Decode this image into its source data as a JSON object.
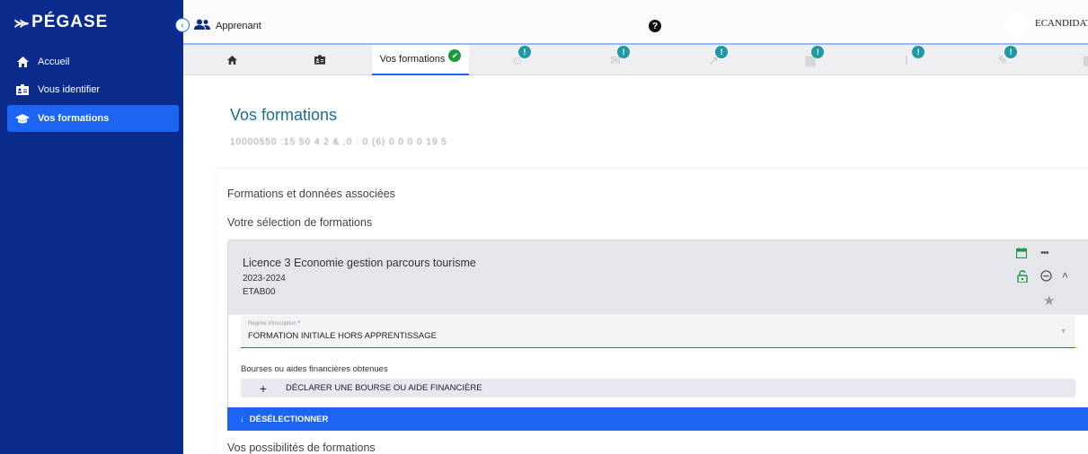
{
  "sidebar": {
    "brand": "PÉGASE",
    "items": [
      {
        "label": "Accueil",
        "icon": "home-icon"
      },
      {
        "label": "Vous identifier",
        "icon": "id-card-icon"
      },
      {
        "label": "Vos formations",
        "icon": "graduation-cap-icon",
        "active": true
      }
    ]
  },
  "header": {
    "role": "Apprenant",
    "help": "?",
    "username": "ECANDIDAT_"
  },
  "tabs": [
    {
      "label": "",
      "icon": "home-icon"
    },
    {
      "label": "",
      "icon": "id-card-icon"
    },
    {
      "label": "Vos formations",
      "icon": "check-badge-icon",
      "active": true
    },
    {
      "label": "",
      "icon": "face-icon",
      "badge": "!"
    },
    {
      "label": "",
      "icon": "mail-icon",
      "badge": "!"
    },
    {
      "label": "",
      "icon": "chart-icon",
      "badge": "!"
    },
    {
      "label": "",
      "icon": "calculator-icon",
      "badge": "!"
    },
    {
      "label": "",
      "icon": "paperclip-icon",
      "badge": "!"
    },
    {
      "label": "",
      "icon": "pen-icon",
      "badge": "!"
    },
    {
      "label": "",
      "icon": "grid-icon"
    }
  ],
  "main": {
    "title": "Vos formations",
    "subtitle_blurred": "10000550 :15 50 4 2 & ;0 : 0 (6) 0 0 0 0 19 5",
    "section1": "Formations et données associées",
    "section2": "Votre sélection de formations",
    "section3": "Vos possibilités de formations"
  },
  "formation": {
    "name": "Licence 3 Economie gestion parcours tourisme",
    "year": "2023-2024",
    "etab": "ETAB00",
    "regime_label": "Régime d'inscription",
    "regime_required": "*",
    "regime_value": "FORMATION INITIALE HORS APPRENTISSAGE",
    "bourses_label": "Bourses ou aides financières obtenues",
    "declare_label": "DÉCLARER UNE BOURSE OU AIDE FINANCIÈRE",
    "deselect_label": "DÉSÉLECTIONNER"
  },
  "colors": {
    "sidebar": "#0a2a8c",
    "accent": "#1c64f2",
    "title": "#1a6e95",
    "badge": "#1e9aa5",
    "success": "#1c9a3c",
    "formation_icons": "#1c9a3c"
  }
}
